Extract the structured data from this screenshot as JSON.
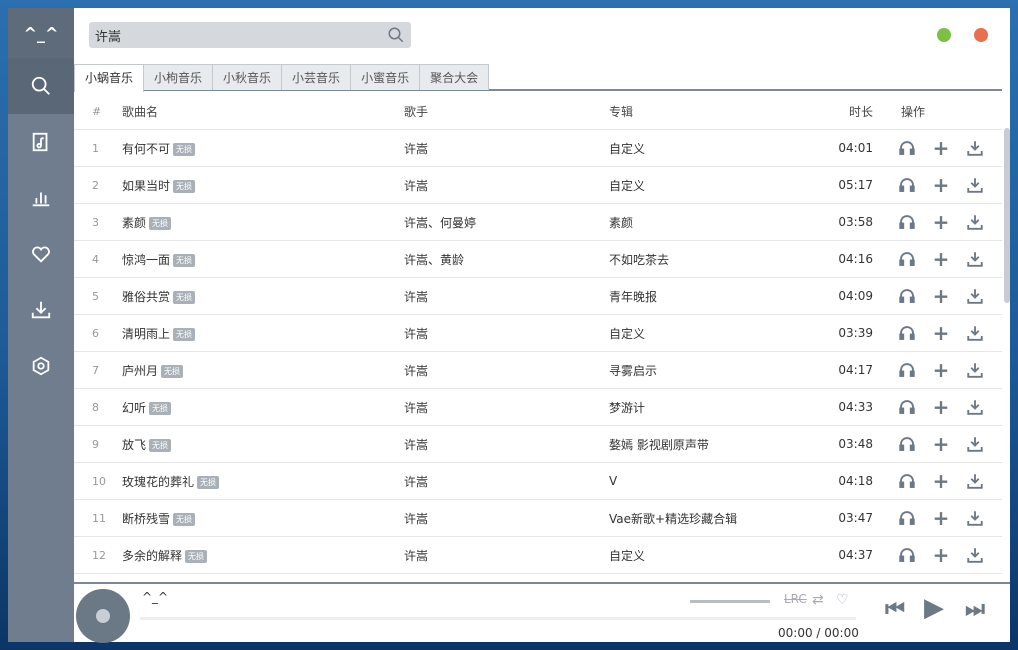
{
  "sidebar": {
    "logo": "^_^",
    "items": [
      {
        "icon": "search-icon"
      },
      {
        "icon": "music-file-icon"
      },
      {
        "icon": "chart-bar-icon"
      },
      {
        "icon": "heart-icon"
      },
      {
        "icon": "download-icon"
      },
      {
        "icon": "settings-icon"
      }
    ]
  },
  "search": {
    "value": "许嵩"
  },
  "window": {
    "min_color": "#7cc043",
    "close_color": "#e8704f"
  },
  "tabs": [
    "小蜗音乐",
    "小枸音乐",
    "小秋音乐",
    "小芸音乐",
    "小蜜音乐",
    "聚合大会"
  ],
  "table": {
    "headers": [
      "#",
      "歌曲名",
      "歌手",
      "专辑",
      "时长",
      "操作"
    ],
    "badge": "无损",
    "rows": [
      [
        "1",
        "有何不可",
        "许嵩",
        "自定义",
        "04:01"
      ],
      [
        "2",
        "如果当时",
        "许嵩",
        "自定义",
        "05:17"
      ],
      [
        "3",
        "素颜",
        "许嵩、何曼婷",
        "素颜",
        "03:58"
      ],
      [
        "4",
        "惊鸿一面",
        "许嵩、黄龄",
        "不如吃茶去",
        "04:16"
      ],
      [
        "5",
        "雅俗共赏",
        "许嵩",
        "青年晚报",
        "04:09"
      ],
      [
        "6",
        "清明雨上",
        "许嵩",
        "自定义",
        "03:39"
      ],
      [
        "7",
        "庐州月",
        "许嵩",
        "寻雾启示",
        "04:17"
      ],
      [
        "8",
        "幻听",
        "许嵩",
        "梦游计",
        "04:33"
      ],
      [
        "9",
        "放飞",
        "许嵩",
        "嫯嫣 影视剧原声带",
        "03:48"
      ],
      [
        "10",
        "玫瑰花的葬礼",
        "许嵩",
        "V",
        "04:18"
      ],
      [
        "11",
        "断桥残雪",
        "许嵩",
        "Vae新歌+精选珍藏合辑",
        "03:47"
      ],
      [
        "12",
        "多余的解释",
        "许嵩",
        "自定义",
        "04:37"
      ]
    ]
  },
  "player": {
    "title": "^_^",
    "lrc": "LRC",
    "time": "00:00 / 00:00"
  }
}
